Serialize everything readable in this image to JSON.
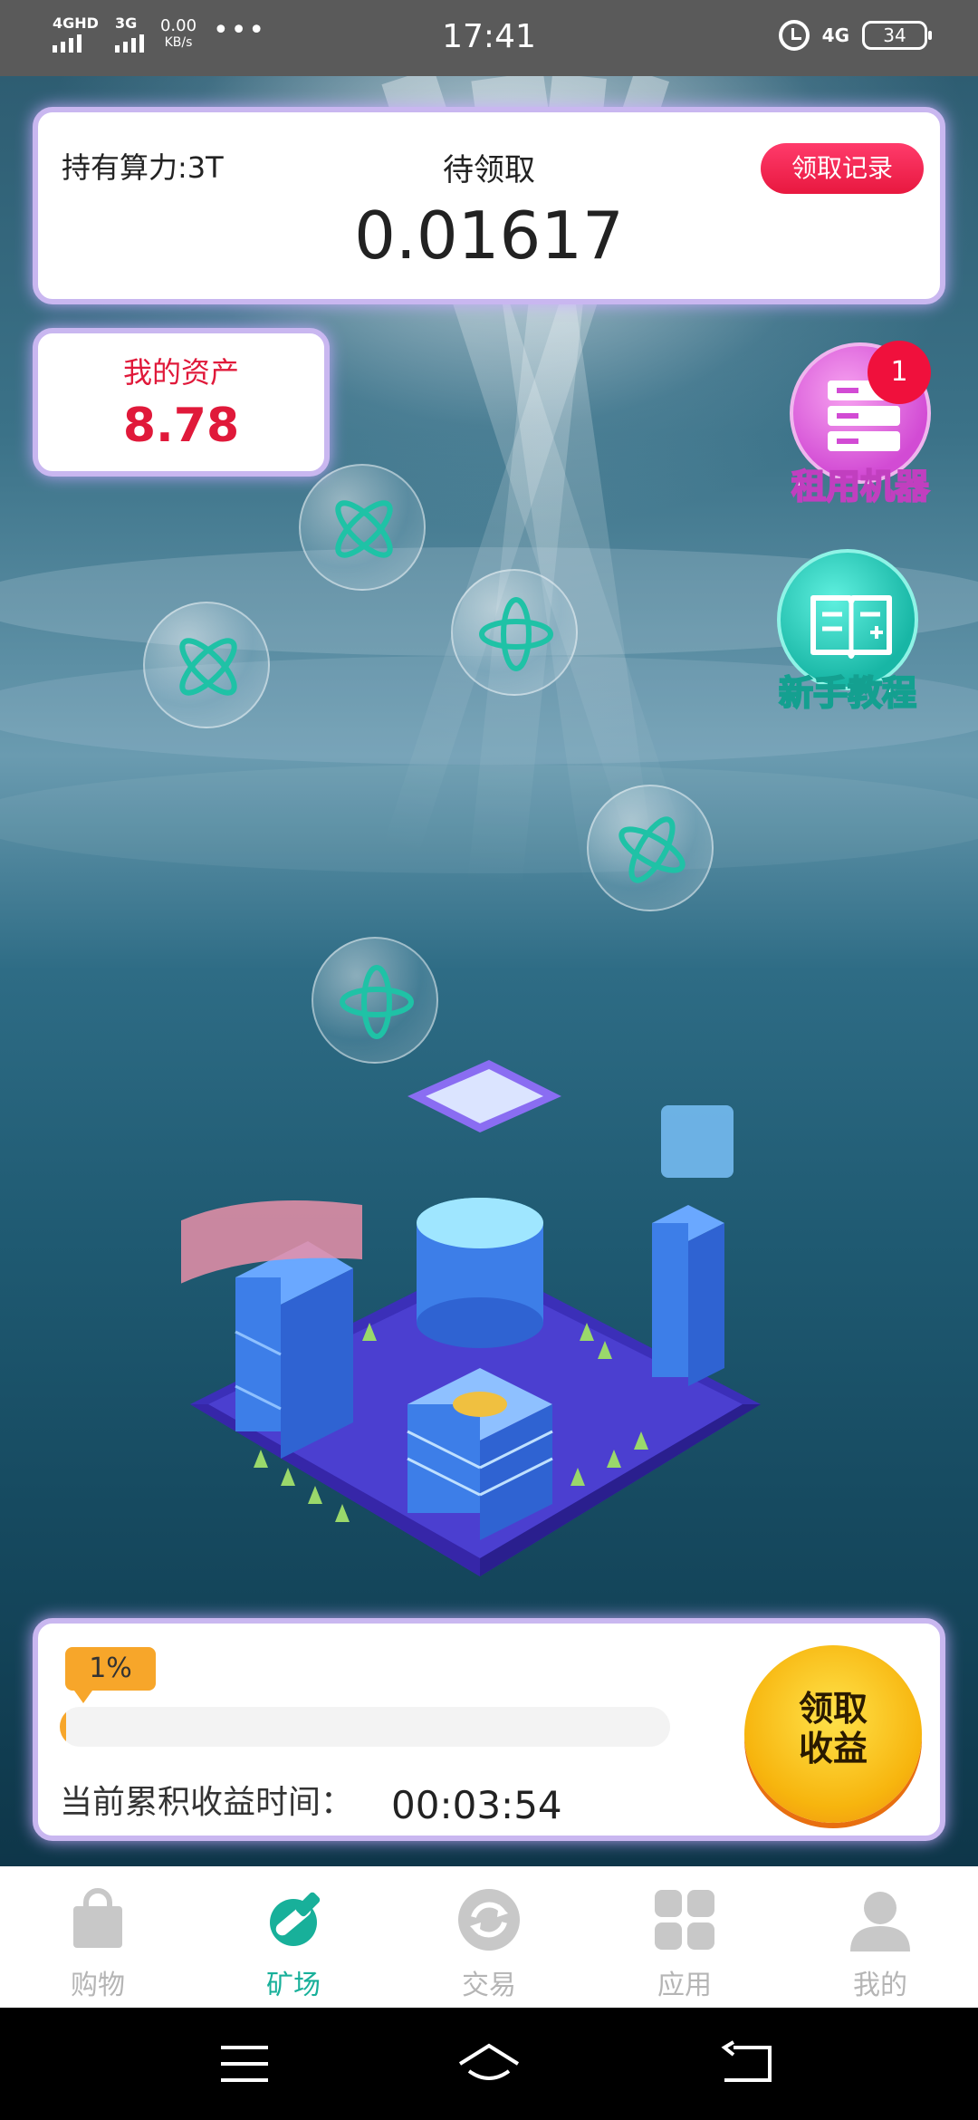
{
  "status_bar": {
    "sig1_label": "4GHD",
    "sig2_label": "3G",
    "net_speed": "0.00",
    "net_unit": "KB/s",
    "time": "17:41",
    "net_type": "4G",
    "battery": "34"
  },
  "mining": {
    "hold_label": "持有算力:3T",
    "pending_label": "待领取",
    "pending_amount": "0.01617",
    "record_button": "领取记录"
  },
  "asset": {
    "label": "我的资产",
    "value": "8.78"
  },
  "float_buttons": {
    "rent_label": "租用机器",
    "rent_badge": "1",
    "tutorial_label": "新手教程"
  },
  "progress": {
    "percent_text": "1%",
    "percent_value": 0.01,
    "accumulated_label": "当前累积收益时间：",
    "accumulated_time": "00:03:54",
    "claim_button": "领取\n收益"
  },
  "nav": {
    "items": [
      {
        "label": "购物",
        "icon": "shopping-bag-icon"
      },
      {
        "label": "矿场",
        "icon": "pickaxe-icon"
      },
      {
        "label": "交易",
        "icon": "exchange-icon"
      },
      {
        "label": "应用",
        "icon": "apps-icon"
      },
      {
        "label": "我的",
        "icon": "profile-icon"
      }
    ],
    "active_index": 1
  },
  "colors": {
    "accent_green": "#18b09a",
    "red": "#e0193a",
    "orange": "#f7a62a",
    "card_border": "#c9b7f0"
  }
}
